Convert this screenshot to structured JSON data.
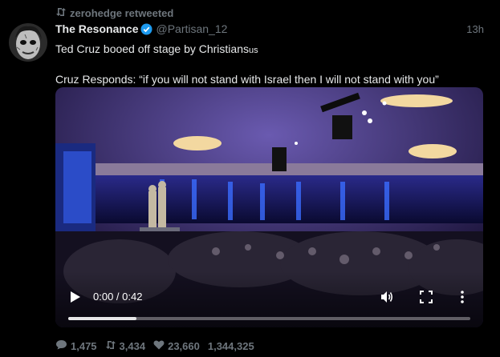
{
  "retweet": {
    "icon": "retweet-icon",
    "text": "zerohedge retweeted"
  },
  "tweet": {
    "author_name": "The Resonance",
    "verified_icon": "verified-badge-icon",
    "handle": "@Partisan_12",
    "time": "13h",
    "line1_main": "Ted Cruz booed off stage by Christians",
    "line1_small": "us",
    "line2": "Cruz Responds: “if you will not stand with Israel then I will not stand with you”"
  },
  "video": {
    "time_display": "0:00 / 0:42",
    "progress": 0.17,
    "icons": [
      "play-icon",
      "volume-icon",
      "fullscreen-icon",
      "more-options-icon"
    ]
  },
  "stats": {
    "replies": "1,475",
    "retweets": "3,434",
    "likes": "23,660",
    "views": "1,344,325"
  },
  "colors": {
    "background": "#000000",
    "text": "#e7e9ea",
    "muted": "#6e767d",
    "verified": "#1d9bf0"
  }
}
